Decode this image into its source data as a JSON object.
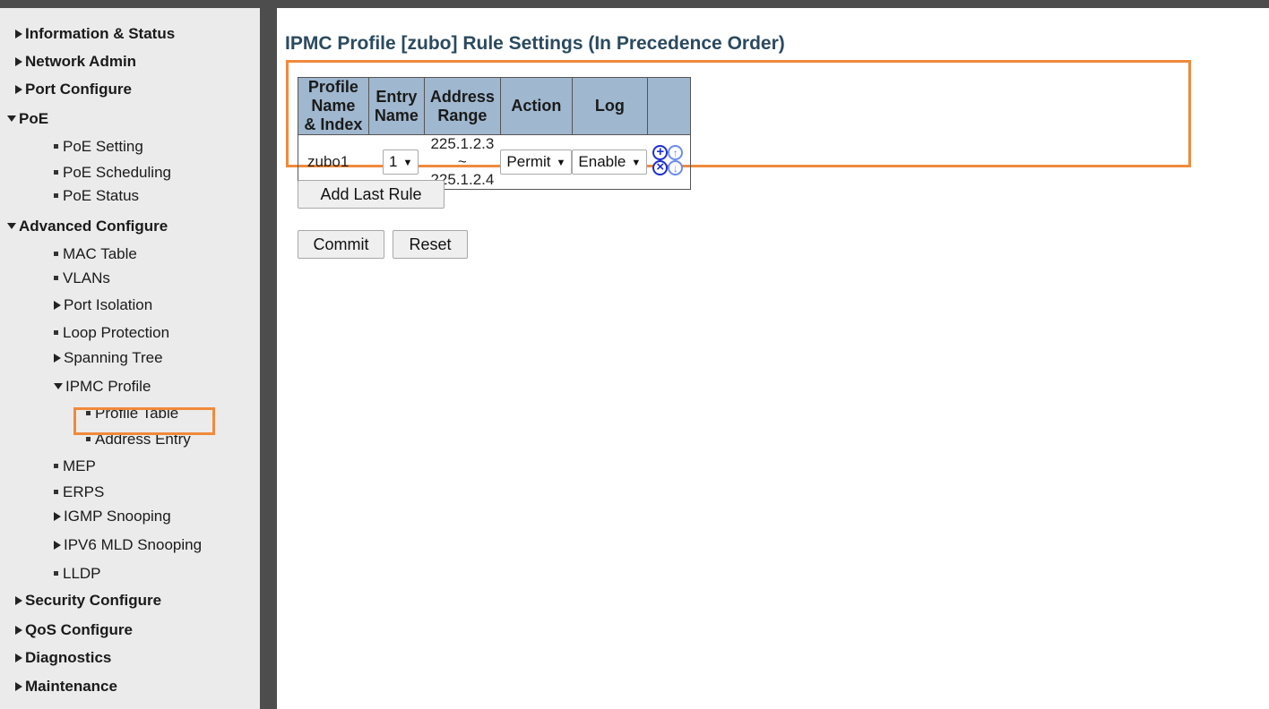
{
  "sidebar": {
    "items": [
      {
        "label": "Information & Status"
      },
      {
        "label": "Network Admin"
      },
      {
        "label": "Port Configure"
      },
      {
        "label": "PoE"
      },
      {
        "label": "PoE Setting"
      },
      {
        "label": "PoE Scheduling"
      },
      {
        "label": "PoE Status"
      },
      {
        "label": "Advanced Configure"
      },
      {
        "label": "MAC Table"
      },
      {
        "label": "VLANs"
      },
      {
        "label": "Port Isolation"
      },
      {
        "label": "Loop Protection"
      },
      {
        "label": "Spanning Tree"
      },
      {
        "label": "IPMC Profile"
      },
      {
        "label": "Profile Table"
      },
      {
        "label": "Address Entry"
      },
      {
        "label": "MEP"
      },
      {
        "label": "ERPS"
      },
      {
        "label": "IGMP Snooping"
      },
      {
        "label": "IPV6 MLD Snooping"
      },
      {
        "label": "LLDP"
      },
      {
        "label": "Security Configure"
      },
      {
        "label": "QoS Configure"
      },
      {
        "label": "Diagnostics"
      },
      {
        "label": "Maintenance"
      }
    ]
  },
  "main": {
    "title": "IPMC Profile [zubo] Rule Settings (In Precedence Order)",
    "table": {
      "headers": [
        "Profile Name & Index",
        "Entry Name",
        "Address Range",
        "Action",
        "Log"
      ],
      "row": {
        "profile_name": "zubo",
        "index": "1",
        "entry_name": "1",
        "address_range": "225.1.2.3 ~ 225.1.2.4",
        "action": "Permit",
        "log": "Enable"
      }
    },
    "buttons": {
      "add_last_rule": "Add Last Rule",
      "commit": "Commit",
      "reset": "Reset"
    },
    "icons": [
      "insert-rule-icon",
      "move-up-icon",
      "delete-rule-icon",
      "move-down-icon"
    ],
    "colors": {
      "highlight": "#f08a3c",
      "header_bg": "#9fb7cf",
      "title": "#2b4a5f",
      "icon": "#1d2fd1"
    }
  }
}
